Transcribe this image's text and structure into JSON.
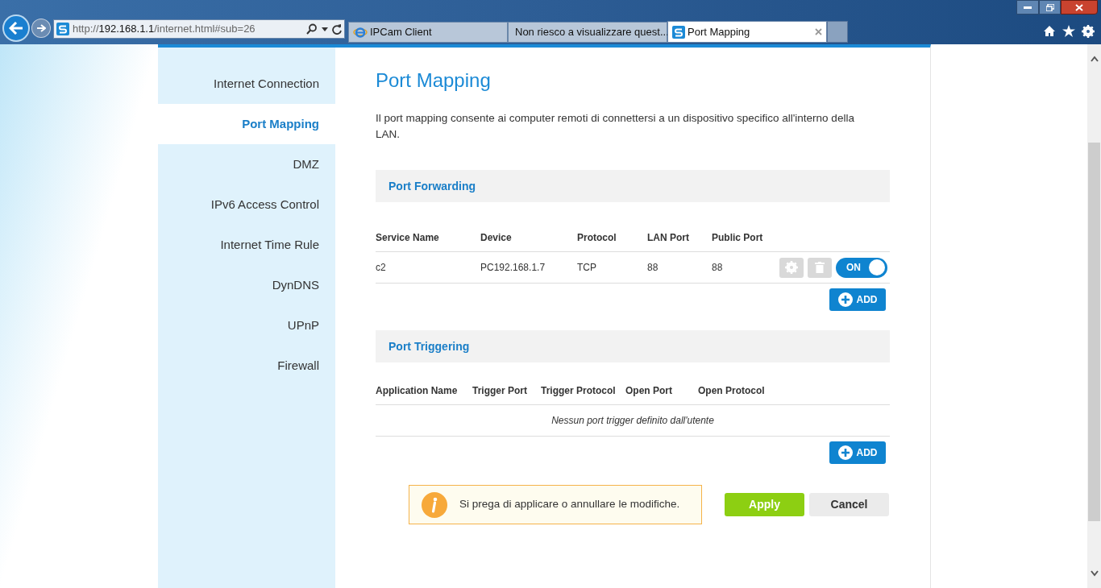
{
  "browser": {
    "address": {
      "host": "192.168.1.1",
      "prefix": "http://",
      "path": "/internet.html#sub=26"
    },
    "tabs": [
      {
        "label": "IPCam Client",
        "selected": false,
        "kind": "ie"
      },
      {
        "label": "Non riesco a visualizzare quest...",
        "selected": false,
        "kind": "ie"
      },
      {
        "label": "Port Mapping",
        "selected": true,
        "kind": "site"
      }
    ]
  },
  "sidebar": {
    "items": [
      {
        "label": "Internet Connection",
        "selected": false
      },
      {
        "label": "Port Mapping",
        "selected": true
      },
      {
        "label": "DMZ",
        "selected": false
      },
      {
        "label": "IPv6 Access Control",
        "selected": false
      },
      {
        "label": "Internet Time Rule",
        "selected": false
      },
      {
        "label": "DynDNS",
        "selected": false
      },
      {
        "label": "UPnP",
        "selected": false
      },
      {
        "label": "Firewall",
        "selected": false
      }
    ]
  },
  "page": {
    "title": "Port Mapping",
    "description": "Il port mapping consente ai computer remoti di connettersi a un dispositivo specifico all'interno della LAN.",
    "port_forwarding": {
      "title": "Port Forwarding",
      "columns": [
        "Service Name",
        "Device",
        "Protocol",
        "LAN Port",
        "Public Port"
      ],
      "rows": [
        {
          "cells": [
            "c2",
            "PC192.168.1.7",
            "TCP",
            "88",
            "88"
          ],
          "on": true,
          "switch_label": "ON"
        }
      ],
      "add_button": "ADD"
    },
    "port_triggering": {
      "title": "Port Triggering",
      "columns": [
        "Application Name",
        "Trigger Port",
        "Trigger Protocol",
        "Open Port",
        "Open Protocol"
      ],
      "empty_message": "Nessun port trigger definito dall'utente",
      "add_button": "ADD"
    },
    "notice": "Si prega di applicare o annullare le modifiche.",
    "apply_button": "Apply",
    "cancel_button": "Cancel"
  }
}
